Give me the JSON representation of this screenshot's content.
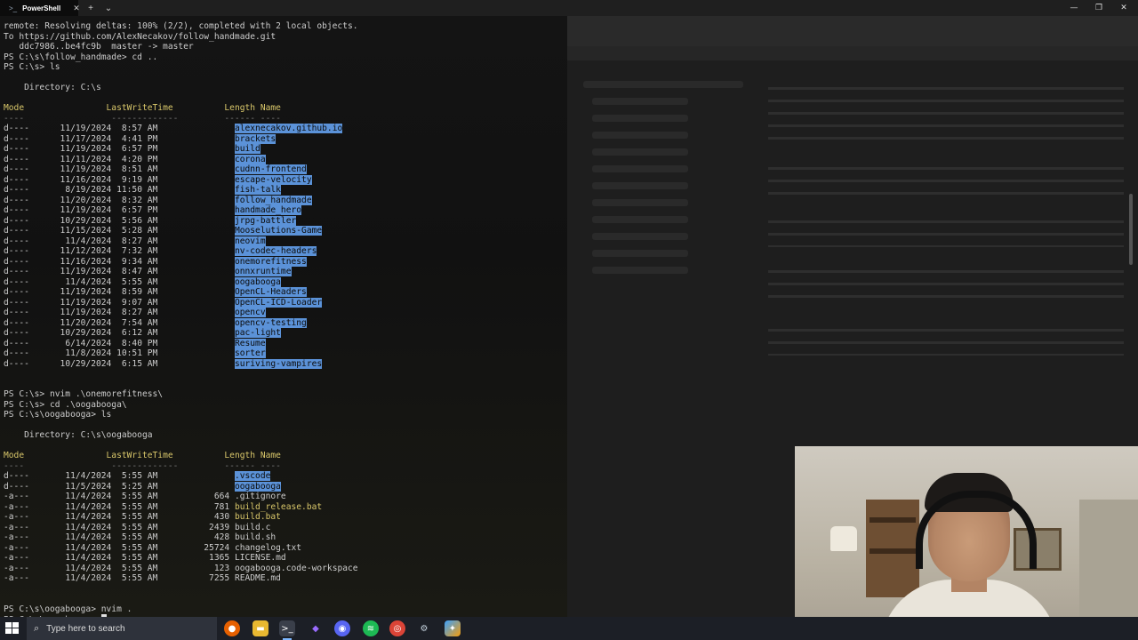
{
  "titlebar": {
    "tab_label": "PowerShell",
    "close_tab": "✕",
    "new_tab": "+",
    "dropdown": "⌄",
    "minimize": "—",
    "maximize": "❐",
    "close_window": "✕"
  },
  "terminal": {
    "pre_lines": [
      "remote: Resolving deltas: 100% (2/2), completed with 2 local objects.",
      "To https://github.com/AlexNecakov/follow_handmade.git",
      "   ddc7986..be4fc9b  master -> master",
      "PS C:\\s\\follow_handmade> cd ..",
      "PS C:\\s> ls"
    ],
    "dir1": {
      "directory_line": "    Directory: C:\\s",
      "header": {
        "mode": "Mode",
        "lwt": "LastWriteTime",
        "length": "Length",
        "name": "Name"
      },
      "underline": {
        "mode": "----",
        "lwt": "-------------",
        "length": "------",
        "name": "----"
      },
      "entries": [
        {
          "mode": "d----",
          "date": "11/19/2024",
          "time": "8:57 AM",
          "length": "",
          "name": "alexnecakov.github.io",
          "is_dir": true
        },
        {
          "mode": "d----",
          "date": "11/17/2024",
          "time": "4:41 PM",
          "length": "",
          "name": "brackets",
          "is_dir": true
        },
        {
          "mode": "d----",
          "date": "11/19/2024",
          "time": "6:57 PM",
          "length": "",
          "name": "build",
          "is_dir": true
        },
        {
          "mode": "d----",
          "date": "11/11/2024",
          "time": "4:20 PM",
          "length": "",
          "name": "corona",
          "is_dir": true
        },
        {
          "mode": "d----",
          "date": "11/19/2024",
          "time": "8:51 AM",
          "length": "",
          "name": "cudnn-frontend",
          "is_dir": true
        },
        {
          "mode": "d----",
          "date": "11/16/2024",
          "time": "9:19 AM",
          "length": "",
          "name": "escape-velocity",
          "is_dir": true
        },
        {
          "mode": "d----",
          "date": "8/19/2024",
          "time": "11:50 AM",
          "length": "",
          "name": "fish-talk",
          "is_dir": true
        },
        {
          "mode": "d----",
          "date": "11/20/2024",
          "time": "8:32 AM",
          "length": "",
          "name": "follow_handmade",
          "is_dir": true
        },
        {
          "mode": "d----",
          "date": "11/19/2024",
          "time": "6:57 PM",
          "length": "",
          "name": "handmade_hero",
          "is_dir": true
        },
        {
          "mode": "d----",
          "date": "10/29/2024",
          "time": "5:56 AM",
          "length": "",
          "name": "jrpg-battler",
          "is_dir": true
        },
        {
          "mode": "d----",
          "date": "11/15/2024",
          "time": "5:28 AM",
          "length": "",
          "name": "Mooselutions-Game",
          "is_dir": true
        },
        {
          "mode": "d----",
          "date": "11/4/2024",
          "time": "8:27 AM",
          "length": "",
          "name": "neovim",
          "is_dir": true
        },
        {
          "mode": "d----",
          "date": "11/12/2024",
          "time": "7:32 AM",
          "length": "",
          "name": "nv-codec-headers",
          "is_dir": true
        },
        {
          "mode": "d----",
          "date": "11/16/2024",
          "time": "9:34 AM",
          "length": "",
          "name": "onemorefitness",
          "is_dir": true
        },
        {
          "mode": "d----",
          "date": "11/19/2024",
          "time": "8:47 AM",
          "length": "",
          "name": "onnxruntime",
          "is_dir": true
        },
        {
          "mode": "d----",
          "date": "11/4/2024",
          "time": "5:55 AM",
          "length": "",
          "name": "oogabooga",
          "is_dir": true
        },
        {
          "mode": "d----",
          "date": "11/19/2024",
          "time": "8:59 AM",
          "length": "",
          "name": "OpenCL-Headers",
          "is_dir": true
        },
        {
          "mode": "d----",
          "date": "11/19/2024",
          "time": "9:07 AM",
          "length": "",
          "name": "OpenCL-ICD-Loader",
          "is_dir": true
        },
        {
          "mode": "d----",
          "date": "11/19/2024",
          "time": "8:27 AM",
          "length": "",
          "name": "opencv",
          "is_dir": true
        },
        {
          "mode": "d----",
          "date": "11/20/2024",
          "time": "7:54 AM",
          "length": "",
          "name": "opencv-testing",
          "is_dir": true
        },
        {
          "mode": "d----",
          "date": "10/29/2024",
          "time": "6:12 AM",
          "length": "",
          "name": "pac-light",
          "is_dir": true
        },
        {
          "mode": "d----",
          "date": "6/14/2024",
          "time": "8:40 PM",
          "length": "",
          "name": "Resume",
          "is_dir": true
        },
        {
          "mode": "d----",
          "date": "11/8/2024",
          "time": "10:51 PM",
          "length": "",
          "name": "sorter",
          "is_dir": true
        },
        {
          "mode": "d----",
          "date": "10/29/2024",
          "time": "6:15 AM",
          "length": "",
          "name": "suriving-vampires",
          "is_dir": true
        }
      ]
    },
    "mid_lines": [
      "PS C:\\s> nvim .\\onemorefitness\\",
      "PS C:\\s> cd .\\oogabooga\\",
      "PS C:\\s\\oogabooga> ls"
    ],
    "dir2": {
      "directory_line": "    Directory: C:\\s\\oogabooga",
      "header": {
        "mode": "Mode",
        "lwt": "LastWriteTime",
        "length": "Length",
        "name": "Name"
      },
      "underline": {
        "mode": "----",
        "lwt": "-------------",
        "length": "------",
        "name": "----"
      },
      "entries": [
        {
          "mode": "d----",
          "date": "11/4/2024",
          "time": "5:55 AM",
          "length": "",
          "name": ".vscode",
          "is_dir": true
        },
        {
          "mode": "d----",
          "date": "11/5/2024",
          "time": "5:25 AM",
          "length": "",
          "name": "oogabooga",
          "is_dir": true
        },
        {
          "mode": "-a---",
          "date": "11/4/2024",
          "time": "5:55 AM",
          "length": "664",
          "name": ".gitignore",
          "is_dir": false
        },
        {
          "mode": "-a---",
          "date": "11/4/2024",
          "time": "5:55 AM",
          "length": "781",
          "name": "build_release.bat",
          "is_dir": false,
          "color": "#d9c76a"
        },
        {
          "mode": "-a---",
          "date": "11/4/2024",
          "time": "5:55 AM",
          "length": "430",
          "name": "build.bat",
          "is_dir": false,
          "color": "#d9c76a"
        },
        {
          "mode": "-a---",
          "date": "11/4/2024",
          "time": "5:55 AM",
          "length": "2439",
          "name": "build.c",
          "is_dir": false
        },
        {
          "mode": "-a---",
          "date": "11/4/2024",
          "time": "5:55 AM",
          "length": "428",
          "name": "build.sh",
          "is_dir": false
        },
        {
          "mode": "-a---",
          "date": "11/4/2024",
          "time": "5:55 AM",
          "length": "25724",
          "name": "changelog.txt",
          "is_dir": false
        },
        {
          "mode": "-a---",
          "date": "11/4/2024",
          "time": "5:55 AM",
          "length": "1365",
          "name": "LICENSE.md",
          "is_dir": false
        },
        {
          "mode": "-a---",
          "date": "11/4/2024",
          "time": "5:55 AM",
          "length": "123",
          "name": "oogabooga.code-workspace",
          "is_dir": false
        },
        {
          "mode": "-a---",
          "date": "11/4/2024",
          "time": "5:55 AM",
          "length": "7255",
          "name": "README.md",
          "is_dir": false
        }
      ]
    },
    "end_lines": [
      "PS C:\\s\\oogabooga> nvim .",
      "PS C:\\s\\oogabooga> "
    ]
  },
  "taskbar": {
    "search_placeholder": "Type here to search",
    "apps": [
      "firefox-icon",
      "file-explorer-icon",
      "terminal-icon",
      "obsidian-icon",
      "discord-icon",
      "spotify-icon",
      "chrome-icon",
      "steam-icon",
      "copilot-icon"
    ]
  },
  "colors": {
    "dir_highlight": "#5b92d8",
    "header_yellow": "#d9c76a",
    "terminal_text": "#cccccc",
    "taskbar_bg": "#1c1f26"
  }
}
